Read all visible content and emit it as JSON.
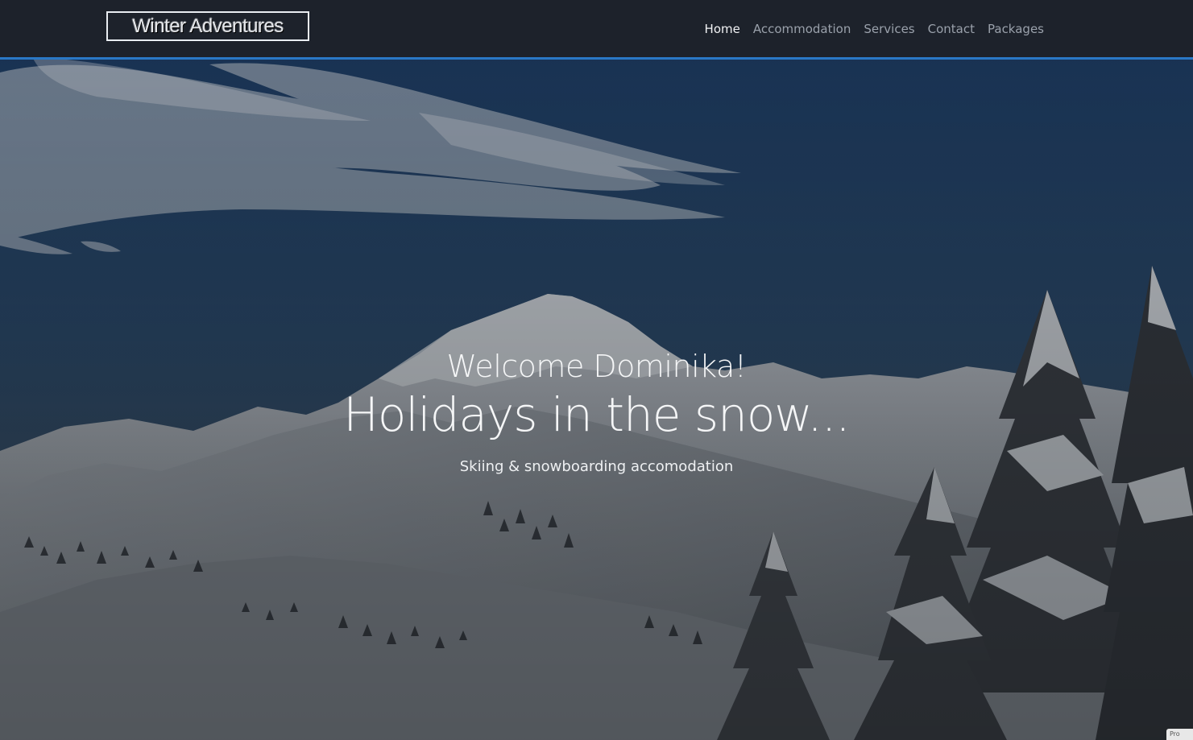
{
  "navbar": {
    "brand": "Winter Adventures",
    "links": [
      {
        "label": "Home",
        "active": true
      },
      {
        "label": "Accommodation",
        "active": false
      },
      {
        "label": "Services",
        "active": false
      },
      {
        "label": "Contact",
        "active": false
      },
      {
        "label": "Packages",
        "active": false
      }
    ]
  },
  "hero": {
    "welcome": "Welcome Dominika!",
    "headline": "Holidays in the snow...",
    "subline": "Skiing & snowboarding accomodation"
  },
  "corner_badge": "Pro",
  "colors": {
    "navbar_bg": "#1d222b",
    "accent_border": "#2a78c6",
    "nav_active": "#f1f2f4",
    "nav_inactive": "#9aa1ab"
  }
}
